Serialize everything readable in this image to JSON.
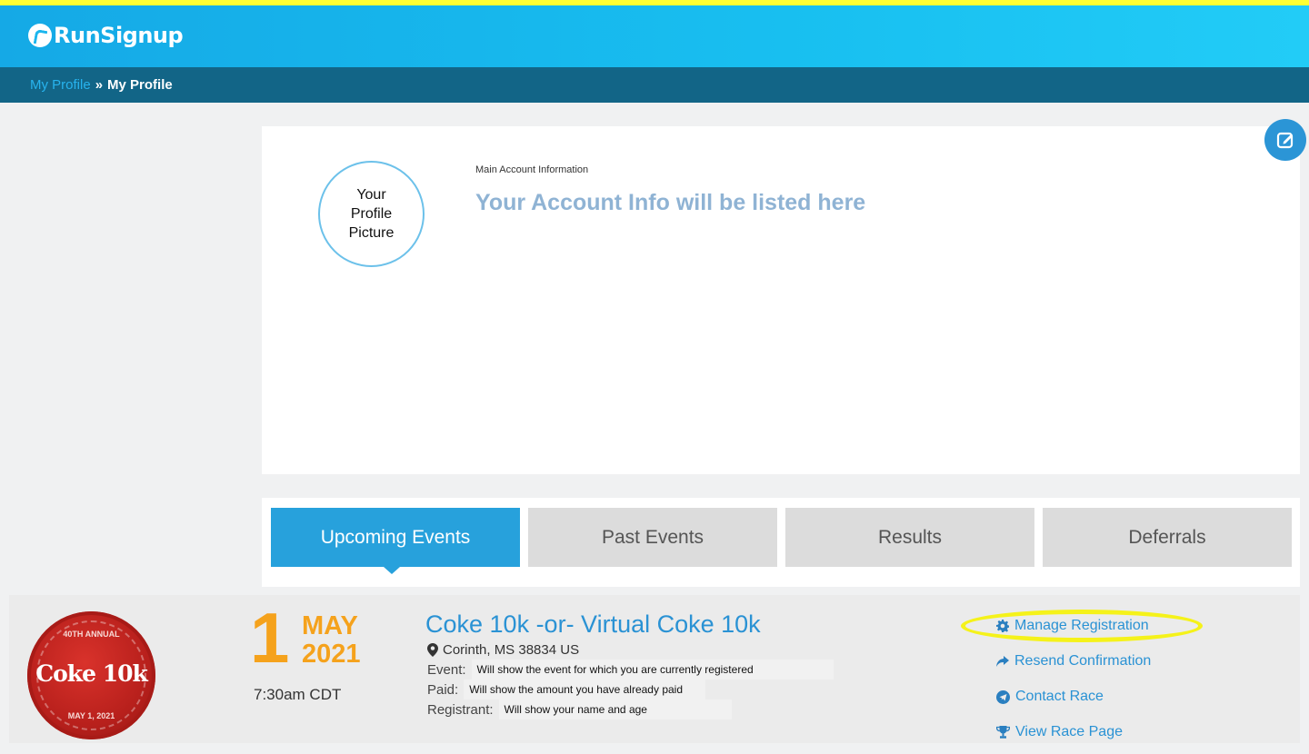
{
  "header": {
    "logo_text": "RunSignup"
  },
  "breadcrumb": {
    "link": "My Profile",
    "separator": "»",
    "current": "My Profile"
  },
  "account": {
    "profile_picture_text": "Your\nProfile\nPicture",
    "section_label": "Main Account Information",
    "info_placeholder": "Your Account Info will be listed here",
    "edit_icon": "edit-icon"
  },
  "tabs": [
    {
      "label": "Upcoming Events",
      "active": true
    },
    {
      "label": "Past Events",
      "active": false
    },
    {
      "label": "Results",
      "active": false
    },
    {
      "label": "Deferrals",
      "active": false
    }
  ],
  "event": {
    "logo": {
      "top": "40TH ANNUAL",
      "name": "Coke 10k",
      "bottom": "MAY 1, 2021"
    },
    "date": {
      "day": "1",
      "month": "MAY",
      "year": "2021",
      "time": "7:30am CDT"
    },
    "title": "Coke 10k -or- Virtual Coke 10k",
    "location": "Corinth, MS 38834 US",
    "rows": {
      "event": {
        "label": "Event:",
        "value": "Will show the event for which you are currently registered"
      },
      "paid": {
        "label": "Paid:",
        "value": "Will show the amount you have already paid"
      },
      "registrant": {
        "label": "Registrant:",
        "value": "Will show your name and age"
      }
    },
    "actions": {
      "manage": "Manage Registration",
      "resend": "Resend Confirmation",
      "contact": "Contact Race",
      "view": "View Race Page"
    }
  },
  "colors": {
    "accent": "#27a1dc",
    "date_orange": "#f5a21c",
    "highlight": "#f5f21a"
  }
}
